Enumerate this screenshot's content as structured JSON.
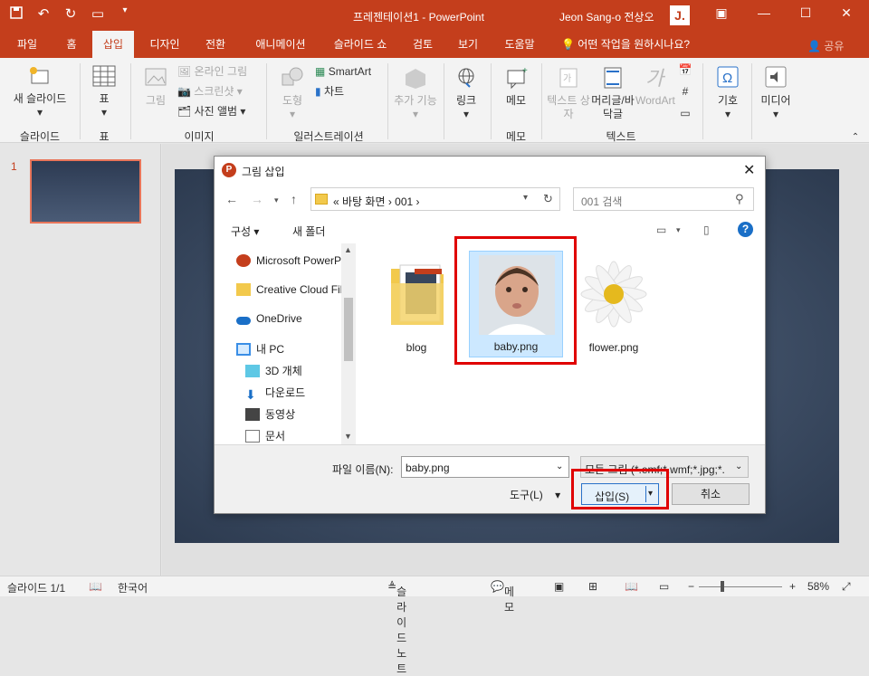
{
  "titlebar": {
    "title": "프레젠테이션1  -  PowerPoint",
    "user": "Jeon Sang-o 전상오",
    "avatar": "J.",
    "qat_icons": [
      "save-icon",
      "undo-icon",
      "redo-icon",
      "start-slideshow-icon",
      "customize-qat-icon"
    ],
    "window_icons": [
      "ribbon-display-icon",
      "minimize-icon",
      "maximize-icon",
      "close-icon"
    ]
  },
  "tabs": [
    "파일",
    "홈",
    "삽입",
    "디자인",
    "전환",
    "애니메이션",
    "슬라이드 쇼",
    "검토",
    "보기",
    "도움말"
  ],
  "active_tab": "삽입",
  "tell_me": "어떤 작업을 원하시나요?",
  "share": "공유",
  "ribbon": {
    "new_slide": "새 슬라이드",
    "table": "표",
    "picture": "그림",
    "online_picture": "온라인 그림",
    "screenshot": "스크린샷",
    "photo_album": "사진 앨범",
    "shapes": "도형",
    "smartart": "SmartArt",
    "chart": "차트",
    "addins": "추가 기능",
    "link": "링크",
    "comment": "메모",
    "textbox": "텍스트 상자",
    "header_footer": "머리글/바닥글",
    "wordart": "WordArt",
    "symbols": "기호",
    "media": "미디어",
    "groups": {
      "slides": "슬라이드",
      "tables": "표",
      "images": "이미지",
      "illustrations": "일러스트레이션",
      "comments": "메모",
      "text": "텍스트"
    }
  },
  "slide_pane": {
    "number": "1"
  },
  "status": {
    "slide_info": "슬라이드 1/1",
    "language": "한국어",
    "notes": "슬라이드 노트",
    "comments": "메모",
    "zoom": "58%",
    "zoom_minus": "−",
    "zoom_plus": "+"
  },
  "dialog": {
    "title": "그림 삽입",
    "path": "«  바탕 화면  ›  001  ›",
    "search_placeholder": "001 검색",
    "organize": "구성 ▾",
    "new_folder": "새 폴더",
    "nav_items": [
      {
        "label": "Microsoft PowerP",
        "icon": "powerpoint-icon"
      },
      {
        "label": "Creative Cloud Fil",
        "icon": "creative-cloud-icon"
      },
      {
        "label": "OneDrive",
        "icon": "onedrive-icon"
      },
      {
        "label": "내 PC",
        "icon": "pc-icon"
      },
      {
        "label": "3D 개체",
        "icon": "3d-objects-icon"
      },
      {
        "label": "다운로드",
        "icon": "download-icon"
      },
      {
        "label": "동영상",
        "icon": "video-icon"
      },
      {
        "label": "문서",
        "icon": "document-icon"
      }
    ],
    "files": [
      {
        "name": "blog",
        "type": "folder",
        "selected": false
      },
      {
        "name": "baby.png",
        "type": "image",
        "selected": true
      },
      {
        "name": "flower.png",
        "type": "image",
        "selected": false
      }
    ],
    "filename_label": "파일 이름(N):",
    "filename_value": "baby.png",
    "filetype": "모든 그림 (*.emf;*.wmf;*.jpg;*.",
    "tools": "도구(L)",
    "insert": "삽입(S)",
    "cancel": "취소"
  },
  "colors": {
    "accent": "#c43e1c",
    "highlight": "#e00000",
    "selection": "#cce8ff"
  }
}
